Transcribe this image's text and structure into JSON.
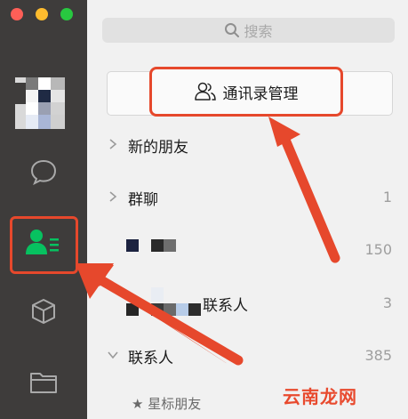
{
  "window": {
    "traffic_lights": [
      "#ff5f57",
      "#febc2e",
      "#28c840"
    ]
  },
  "search": {
    "placeholder": "搜索",
    "icon": "magnifier-icon"
  },
  "contacts_manager": {
    "label": "通讯录管理",
    "icon": "contacts-people-icon"
  },
  "sections": [
    {
      "label": "新的朋友",
      "count": ""
    },
    {
      "label": "群聊",
      "count": "1"
    },
    {
      "label": "",
      "count": "150"
    },
    {
      "label": "联系人",
      "count": "3"
    },
    {
      "label": "联系人",
      "count": "385"
    }
  ],
  "starred": {
    "label": "★ 星标朋友"
  },
  "sidebar": {
    "icons": [
      "chat-bubble-icon",
      "contacts-icon",
      "cube-icon",
      "folder-icon"
    ],
    "active": "contacts-icon"
  },
  "watermark": "云南龙网",
  "colors": {
    "sidebar_bg": "#3e3c3b",
    "active_green": "#07c160",
    "highlight_red": "#e6482c"
  }
}
